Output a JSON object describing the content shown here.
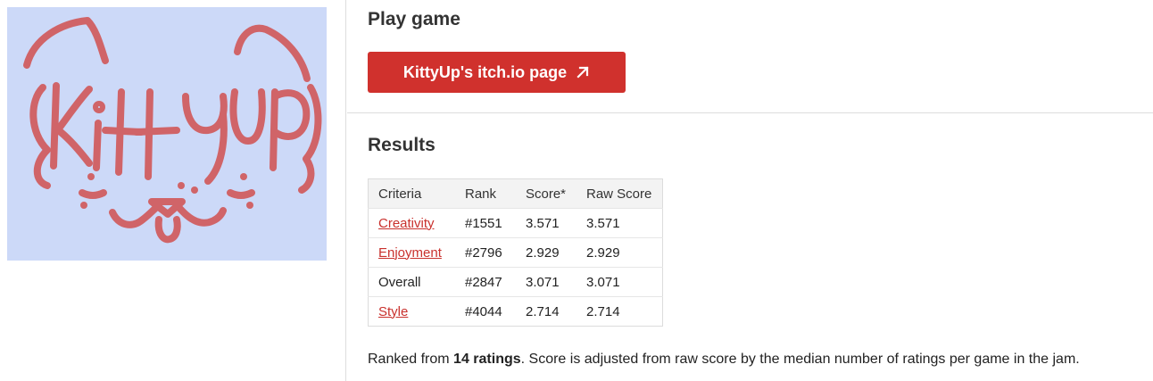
{
  "cover": {
    "logo_text": "KittyUp",
    "background_color": "#ccd9f8",
    "ink_color": "#d06468"
  },
  "play_section": {
    "title": "Play game",
    "button_label": "KittyUp's itch.io page",
    "button_icon": "external-link-icon",
    "button_color": "#d0312d"
  },
  "results_section": {
    "title": "Results",
    "table": {
      "headers": {
        "criteria": "Criteria",
        "rank": "Rank",
        "score": "Score*",
        "raw_score": "Raw Score"
      },
      "rows": [
        {
          "criteria": "Creativity",
          "rank": "#1551",
          "score": "3.571",
          "raw_score": "3.571",
          "is_link": true
        },
        {
          "criteria": "Enjoyment",
          "rank": "#2796",
          "score": "2.929",
          "raw_score": "2.929",
          "is_link": true
        },
        {
          "criteria": "Overall",
          "rank": "#2847",
          "score": "3.071",
          "raw_score": "3.071",
          "is_link": false
        },
        {
          "criteria": "Style",
          "rank": "#4044",
          "score": "2.714",
          "raw_score": "2.714",
          "is_link": true
        }
      ]
    },
    "footnote": {
      "prefix": "Ranked from ",
      "ratings": "14 ratings",
      "suffix": ". Score is adjusted from raw score by the median number of ratings per game in the jam."
    }
  },
  "colors": {
    "link": "#c9312d",
    "table_header_bg": "#f3f3f3",
    "border": "#dddddd"
  }
}
